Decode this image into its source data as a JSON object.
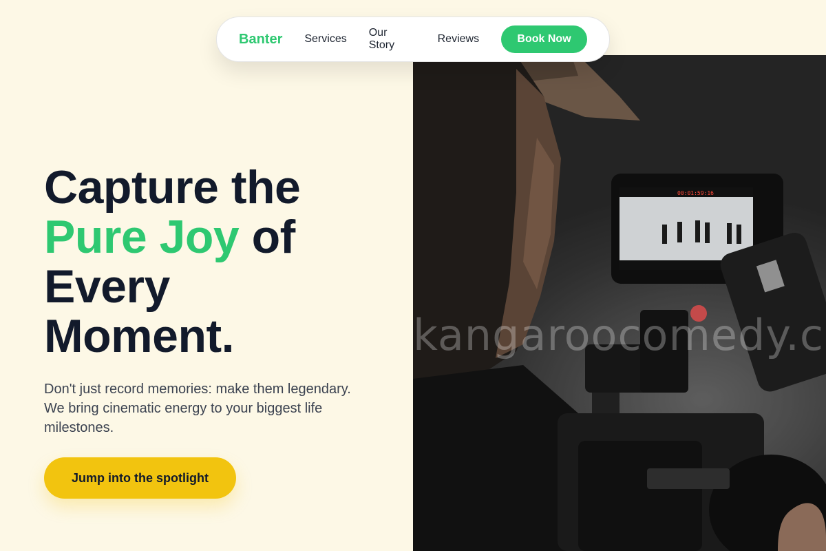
{
  "nav": {
    "brand": "Banter",
    "links": [
      "Services",
      "Our Story",
      "Reviews"
    ],
    "cta_label": "Book Now"
  },
  "hero": {
    "headline_line1": "Capture the",
    "headline_accent": "Pure Joy",
    "headline_line2_rest": " of",
    "headline_line3": "Every",
    "headline_line4": "Moment.",
    "subtext": "Don't just record memories: make them legendary. We bring cinematic energy to your biggest life milestones.",
    "cta_label": "Jump into the spotlight"
  },
  "photo": {
    "watermark": "kangaroocomedy.com",
    "monitor_timecode": "00:01:59:16"
  },
  "colors": {
    "background": "#fdf8e6",
    "accent_green": "#2ec871",
    "cta_yellow": "#f2c40f",
    "headline": "#121a2b"
  }
}
